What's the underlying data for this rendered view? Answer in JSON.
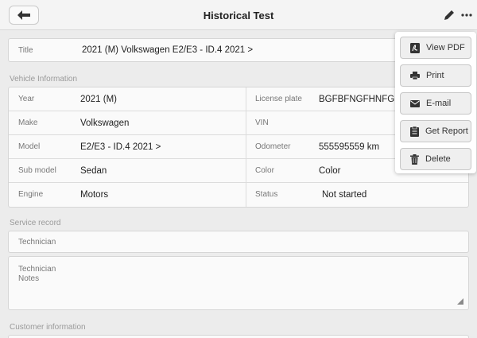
{
  "header": {
    "title": "Historical Test"
  },
  "title_row": {
    "label": "Title",
    "value": "2021 (M) Volkswagen E2/E3 - ID.4 2021 >"
  },
  "vehicle_info": {
    "section_title": "Vehicle Information",
    "rows": [
      {
        "left_label": "Year",
        "left_value": "2021 (M)",
        "right_label": "License plate",
        "right_value": "BGFBFNGFHNFGNF"
      },
      {
        "left_label": "Make",
        "left_value": "Volkswagen",
        "right_label": "VIN",
        "right_value": ""
      },
      {
        "left_label": "Model",
        "left_value": "E2/E3 - ID.4 2021 >",
        "right_label": "Odometer",
        "right_value": "555595559 km"
      },
      {
        "left_label": "Sub model",
        "left_value": "Sedan",
        "right_label": "Color",
        "right_value": "Color"
      },
      {
        "left_label": "Engine",
        "left_value": "Motors",
        "right_label": "Status",
        "right_value": "Not started"
      }
    ]
  },
  "service_record": {
    "section_title": "Service record",
    "technician_label": "Technician",
    "notes_label_line1": "Technician",
    "notes_label_line2": "Notes"
  },
  "customer_info": {
    "section_title": "Customer information"
  },
  "menu": {
    "items": [
      {
        "label": "View PDF",
        "icon": "pdf-icon"
      },
      {
        "label": "Print",
        "icon": "printer-icon"
      },
      {
        "label": "E-mail",
        "icon": "envelope-icon"
      },
      {
        "label": "Get Report",
        "icon": "report-icon"
      },
      {
        "label": "Delete",
        "icon": "trash-icon"
      }
    ]
  }
}
